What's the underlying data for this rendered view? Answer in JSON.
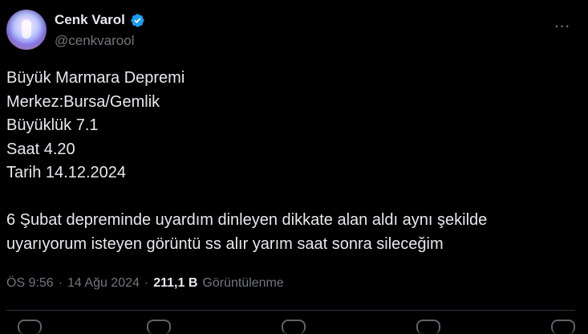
{
  "header": {
    "display_name": "Cenk Varol",
    "handle": "@cenkvarool",
    "verified_icon": "verified-badge-icon",
    "more_icon": "more-horizontal-icon"
  },
  "tweet": {
    "text": "Büyük Marmara Depremi\nMerkez:Bursa/Gemlik\nBüyüklük 7.1\nSaat 4.20\nTarih 14.12.2024\n\n6 Şubat depreminde uyardım dinleyen dikkate alan aldı aynı şekilde\nuyarıyorum isteyen görüntü ss alır yarım saat sonra sileceğim"
  },
  "meta": {
    "time": "ÖS 9:56",
    "sep1": "·",
    "date": "14 Ağu 2024",
    "sep2": "·",
    "views_count": "211,1 B",
    "views_label": "Görüntülenme"
  },
  "colors": {
    "background": "#000000",
    "text": "#e7e9ea",
    "muted": "#71767b",
    "verified": "#1d9bf0",
    "divider": "#2f3336"
  },
  "actions": {
    "icons": [
      "reply-icon",
      "repost-icon",
      "like-icon",
      "bookmark-icon",
      "share-icon"
    ]
  }
}
